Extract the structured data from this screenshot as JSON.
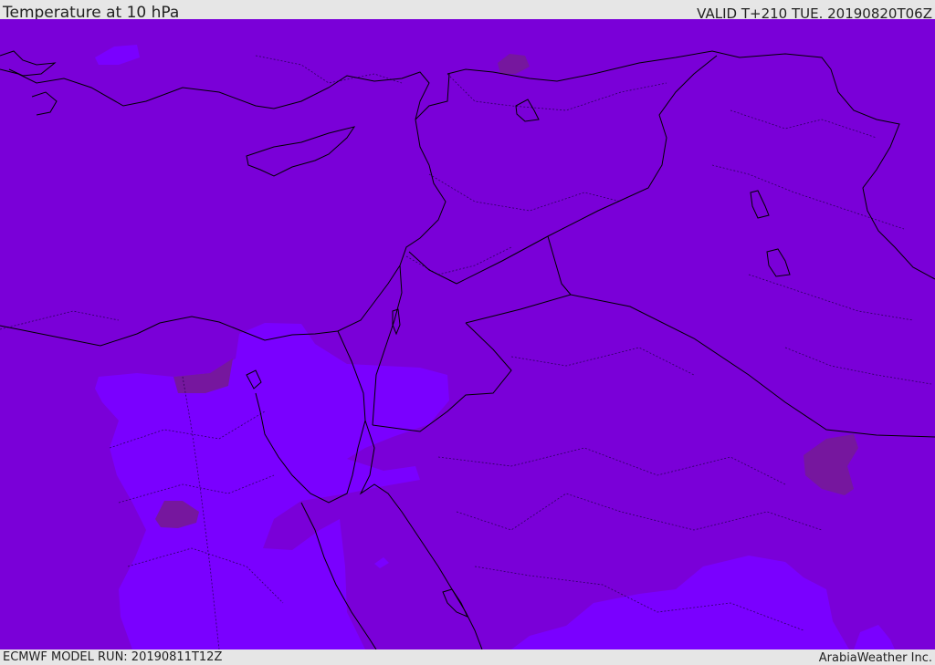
{
  "header": {
    "title": "Temperature at 10 hPa",
    "valid_time": "VALID T+210 TUE. 20190820T06Z"
  },
  "footer": {
    "model_run": "ECMWF MODEL RUN: 20190811T12Z",
    "credit": "ArabiaWeather Inc."
  },
  "colors": {
    "base_field": "#7a00d8",
    "cold_field": "#7a00ff",
    "warm_patch": "#76179e",
    "coastline": "#000000",
    "frame_background": "#e6e6e6"
  }
}
